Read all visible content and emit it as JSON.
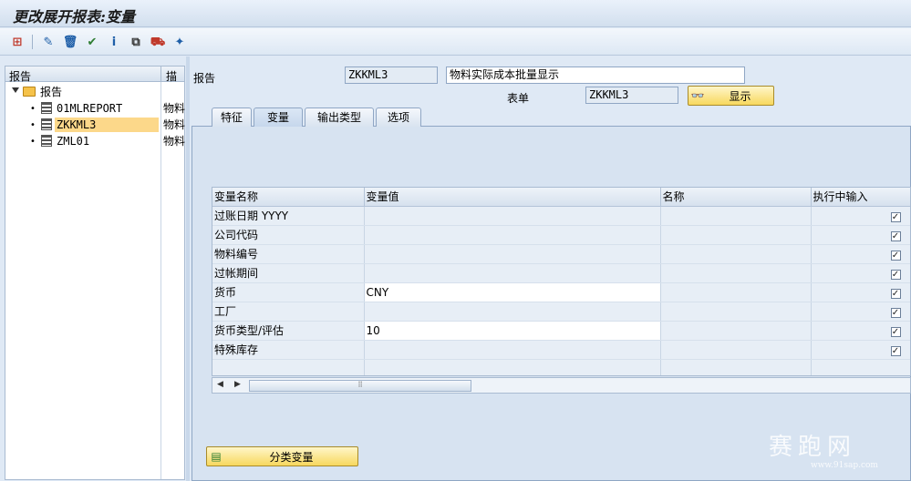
{
  "window": {
    "title": "更改展开报表:变量"
  },
  "toolbar": {
    "items": [
      {
        "name": "hierarchy-icon",
        "glyph": "⊞",
        "color": "#c0392b"
      },
      {
        "name": "edit-glasses-icon",
        "glyph": "✎",
        "color": "#1f5fa8"
      },
      {
        "name": "delete-icon",
        "glyph": "🗑",
        "color": "#1f5fa8"
      },
      {
        "name": "check-icon",
        "glyph": "✔",
        "color": "#2e7d32"
      },
      {
        "name": "info-icon",
        "glyph": "i",
        "color": "#1f5fa8"
      },
      {
        "name": "copy-icon",
        "glyph": "⧉",
        "color": "#333333"
      },
      {
        "name": "transport-icon",
        "glyph": "⛟",
        "color": "#c0392b"
      },
      {
        "name": "magic-wand-icon",
        "glyph": "✦",
        "color": "#1f5fa8"
      }
    ]
  },
  "left_panel": {
    "header_report": "报告",
    "header_desc": "描",
    "root": {
      "label": "报告"
    },
    "items": [
      {
        "label": "01MLREPORT",
        "desc": "物料",
        "selected": false
      },
      {
        "label": "ZKKML3",
        "desc": "物料",
        "selected": true
      },
      {
        "label": "ZML01",
        "desc": "物料",
        "selected": false
      }
    ]
  },
  "header_form": {
    "report_label": "报告",
    "report_value": "ZKKML3",
    "report_desc": "物料实际成本批量显示",
    "form_label": "表单",
    "form_value": "ZKKML3",
    "display_button": "显示"
  },
  "tabs": [
    {
      "label": "特征",
      "active": false
    },
    {
      "label": "变量",
      "active": true
    },
    {
      "label": "输出类型",
      "active": false
    },
    {
      "label": "选项",
      "active": false
    }
  ],
  "grid": {
    "columns": [
      "变量名称",
      "变量值",
      "名称",
      "执行中输入"
    ],
    "rows": [
      {
        "name": "过账日期 YYYY",
        "value": "",
        "text": "",
        "input": true,
        "editable": false
      },
      {
        "name": "公司代码",
        "value": "",
        "text": "",
        "input": true,
        "editable": false
      },
      {
        "name": "物料编号",
        "value": "",
        "text": "",
        "input": true,
        "editable": false
      },
      {
        "name": "过帐期间",
        "value": "",
        "text": "",
        "input": true,
        "editable": false
      },
      {
        "name": "货币",
        "value": "CNY",
        "text": "",
        "input": true,
        "editable": true
      },
      {
        "name": "工厂",
        "value": "",
        "text": "",
        "input": true,
        "editable": false
      },
      {
        "name": "货币类型/评估",
        "value": "10",
        "text": "",
        "input": true,
        "editable": true
      },
      {
        "name": "特殊库存",
        "value": "",
        "text": "",
        "input": true,
        "editable": false
      },
      {
        "name": "",
        "value": "",
        "text": "",
        "input": null,
        "editable": false
      }
    ]
  },
  "bottom": {
    "sort_button": "分类变量"
  },
  "watermark": {
    "main": "赛跑网",
    "url": "www.91sap.com"
  }
}
